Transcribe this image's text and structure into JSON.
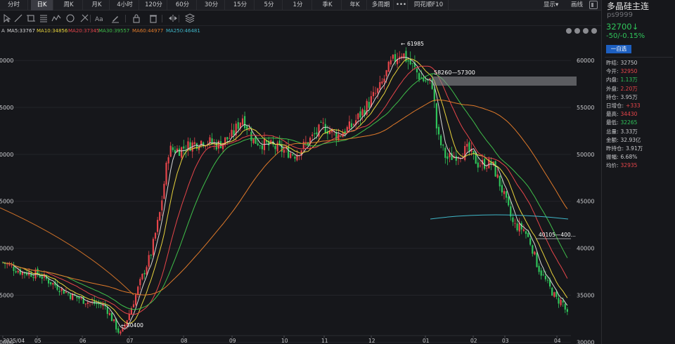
{
  "tabs": [
    "分时",
    "日K",
    "周K",
    "月K",
    "4小时",
    "120分",
    "60分",
    "30分",
    "15分",
    "5分",
    "1分",
    "季K",
    "年K",
    "多周期",
    "•••",
    "同花顺F10"
  ],
  "active_tab": "日K",
  "top_right": {
    "display": "显示",
    "display_arrow": "▾",
    "draw": "画线"
  },
  "toolbar_icons": [
    "cursor-icon",
    "line-icon",
    "crop-icon",
    "grid-lines-icon",
    "zigzag-icon",
    "ellipse-icon",
    "fibonacci-icon",
    "text-icon",
    "pen-icon",
    "lock-icon",
    "trash-icon",
    "collapse-icon",
    "layers-icon"
  ],
  "ma_legend": {
    "prefix": "A",
    "items": [
      {
        "text": "MA5:33767",
        "color": "#d7d7d7"
      },
      {
        "text": "MA10:34856",
        "color": "#e8d33c"
      },
      {
        "text": "MA20:37345",
        "color": "#e6454a"
      },
      {
        "text": "MA30:39557",
        "color": "#3fbf4a"
      },
      {
        "text": "MA60:44977",
        "color": "#e07a2a"
      },
      {
        "text": "MA250:46481",
        "color": "#3fb7c9"
      }
    ]
  },
  "instrument": {
    "name": "多晶硅主连",
    "code": "ps9999",
    "price": "32700↓",
    "change": "-50/-0.15%",
    "button": "一自选"
  },
  "stats": [
    {
      "label": "昨结:",
      "value": "32750",
      "tone": "neutral"
    },
    {
      "label": "今开:",
      "value": "32950",
      "tone": "red"
    },
    {
      "label": "内盘:",
      "value": "1.13万",
      "tone": "green"
    },
    {
      "label": "外盘:",
      "value": "2.20万",
      "tone": "red"
    },
    {
      "label": "持仓:",
      "value": "3.95万",
      "tone": "neutral"
    },
    {
      "label": "日增仓:",
      "value": "+333",
      "tone": "red"
    },
    {
      "label": "最高:",
      "value": "34430",
      "tone": "red"
    },
    {
      "label": "最低:",
      "value": "32265",
      "tone": "green"
    },
    {
      "label": "总量:",
      "value": "3.33万",
      "tone": "neutral"
    },
    {
      "label": "金额:",
      "value": "32.93亿",
      "tone": "neutral"
    },
    {
      "label": "昨持仓:",
      "value": "3.91万",
      "tone": "neutral"
    },
    {
      "label": "振幅:",
      "value": "6.68%",
      "tone": "neutral"
    },
    {
      "label": "均价:",
      "value": "32935",
      "tone": "red"
    }
  ],
  "chart_data": {
    "type": "candlestick",
    "y_ticks_right": [
      "60000",
      "55000",
      "50000",
      "45000",
      "40000",
      "35000",
      "30000"
    ],
    "y_ticks_left": [
      "0000",
      "5000",
      "0000",
      "5000",
      "0000",
      "5000",
      "0000"
    ],
    "x_ticks": [
      "2025/04",
      "05",
      "06",
      "07",
      "08",
      "09",
      "10",
      "11",
      "12",
      "01",
      "02",
      "03",
      "04"
    ],
    "ylim": [
      29800,
      62700
    ],
    "annotations": {
      "high": "61985",
      "low": "30400",
      "zone": "58260—57300",
      "level": "40105—400..."
    },
    "colors": {
      "up": "#e6454a",
      "down": "#2fc45a"
    }
  }
}
